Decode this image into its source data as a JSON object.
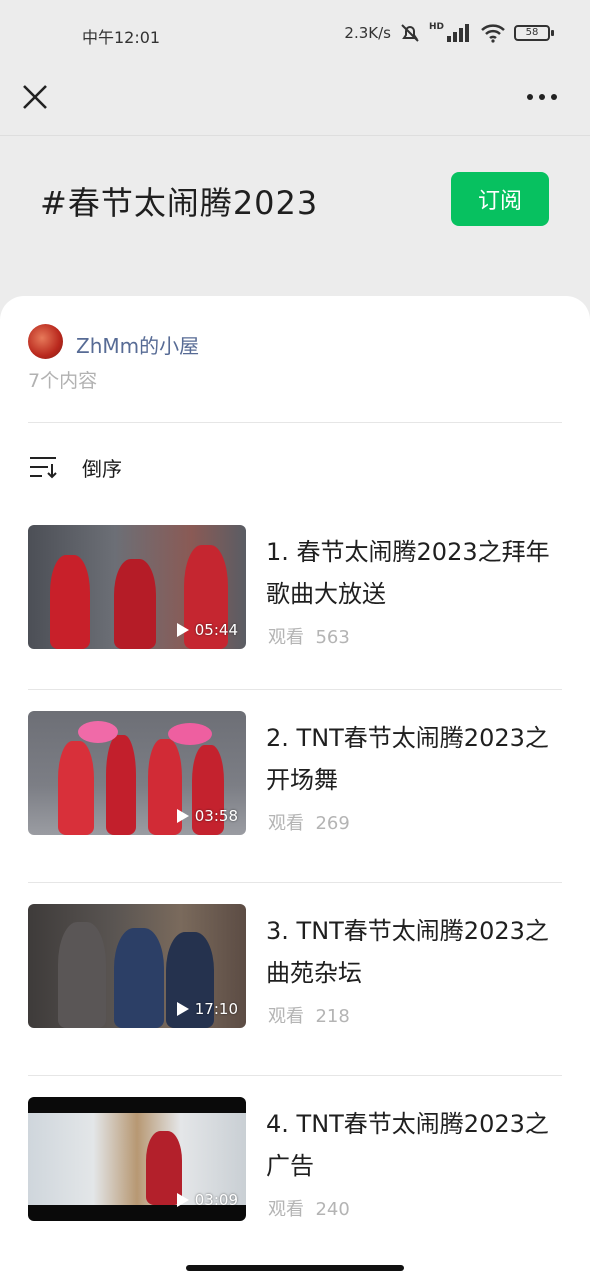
{
  "status_bar": {
    "time": "中午12:01",
    "net_speed": "2.3K/s",
    "network_label": "HD",
    "battery": "58"
  },
  "header": {
    "topic_title": "#春节太闹腾2023",
    "subscribe_label": "订阅"
  },
  "author": {
    "name": "ZhMm的小屋",
    "count_text": "7个内容"
  },
  "sort": {
    "label": "倒序"
  },
  "items": [
    {
      "title": "1. 春节太闹腾2023之拜年歌曲大放送",
      "duration": "05:44",
      "views_label": "观看",
      "views": "563"
    },
    {
      "title": "2. TNT春节太闹腾2023之开场舞",
      "duration": "03:58",
      "views_label": "观看",
      "views": "269"
    },
    {
      "title": "3. TNT春节太闹腾2023之曲苑杂坛",
      "duration": "17:10",
      "views_label": "观看",
      "views": "218"
    },
    {
      "title": "4. TNT春节太闹腾2023之广告",
      "duration": "03:09",
      "views_label": "观看",
      "views": "240"
    }
  ],
  "icons": {
    "close": "close-icon",
    "more": "more-icon",
    "sort": "sort-icon",
    "play": "play-icon",
    "mute": "bell-mute-icon",
    "signal": "signal-icon",
    "wifi": "wifi-icon",
    "battery": "battery-icon"
  },
  "colors": {
    "accent_green": "#07c160",
    "link_blue": "#576b95",
    "muted_gray": "#b4b4b4",
    "background": "#ececec"
  }
}
